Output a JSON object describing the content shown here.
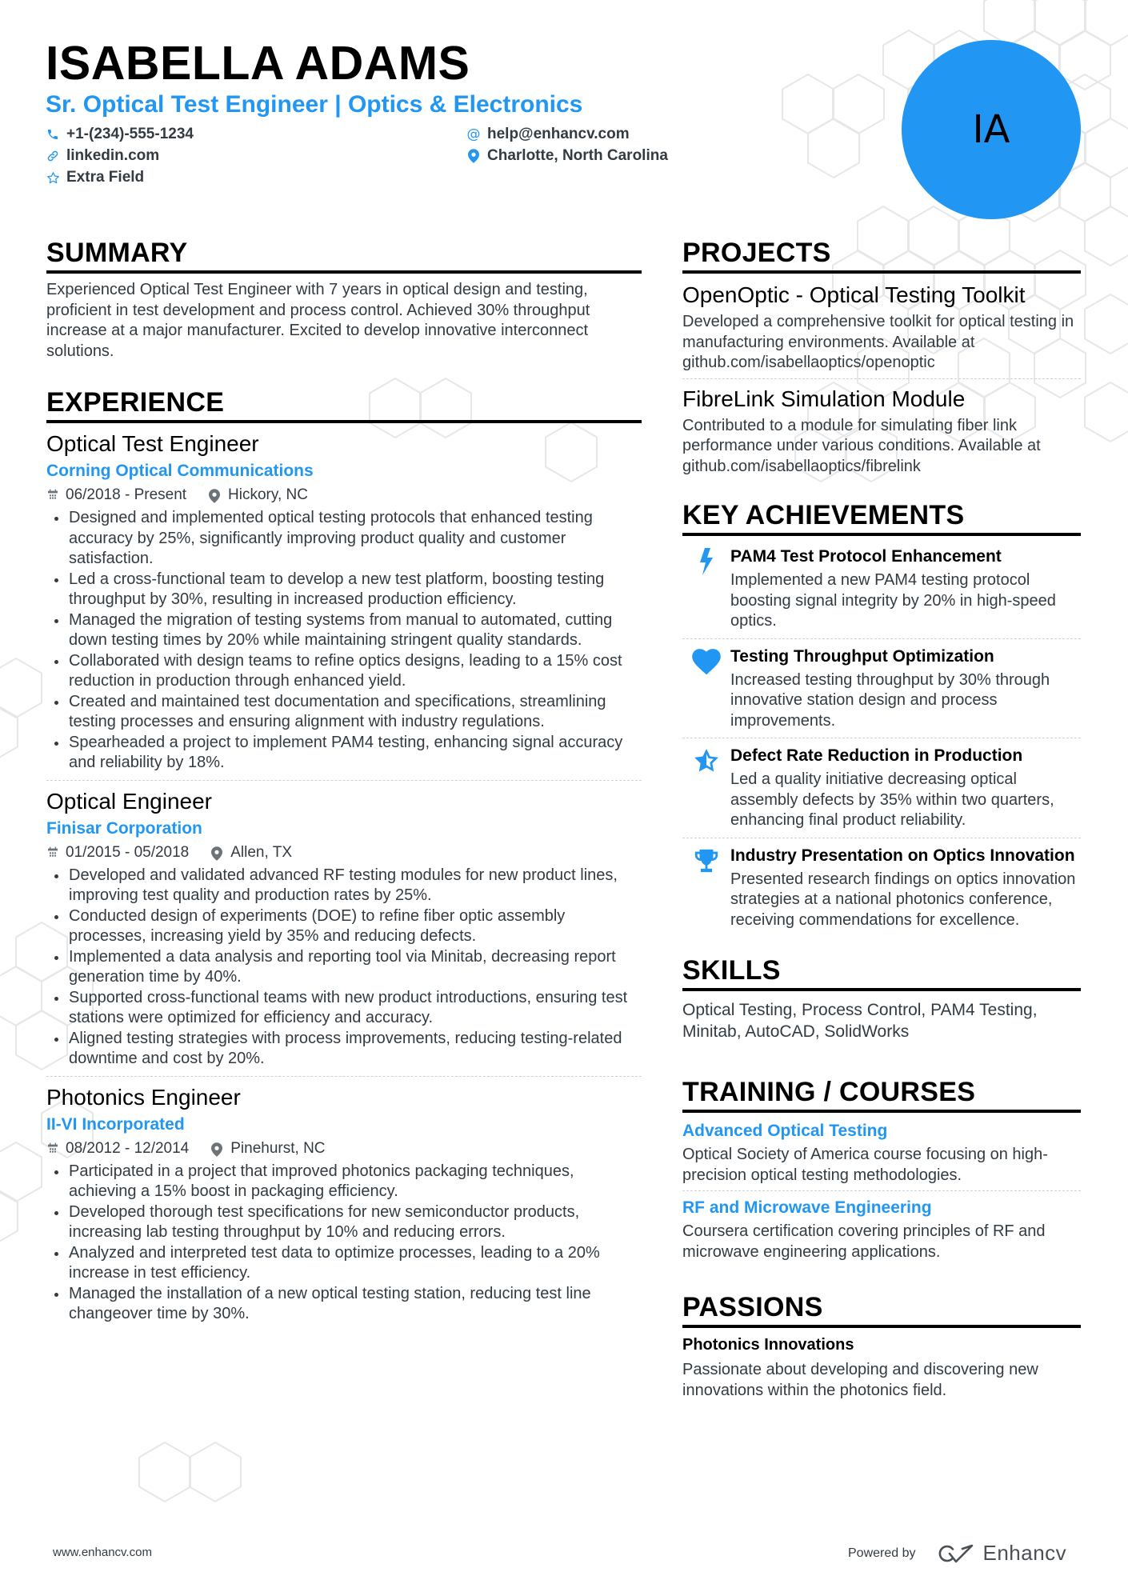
{
  "header": {
    "name": "ISABELLA ADAMS",
    "headline": "Sr. Optical Test Engineer | Optics & Electronics",
    "avatar_initials": "IA",
    "contacts": {
      "phone": "+1-(234)-555-1234",
      "email": "help@enhancv.com",
      "website": "linkedin.com",
      "location": "Charlotte, North Carolina",
      "extra": "Extra Field"
    }
  },
  "summary": {
    "title": "SUMMARY",
    "text": "Experienced Optical Test Engineer with 7 years in optical design and testing, proficient in test development and process control. Achieved 30% throughput increase at a major manufacturer. Excited to develop innovative interconnect solutions."
  },
  "experience": {
    "title": "EXPERIENCE",
    "items": [
      {
        "role": "Optical Test Engineer",
        "company": "Corning Optical Communications",
        "dates": "06/2018 - Present",
        "location": "Hickory, NC",
        "bullets": [
          "Designed and implemented optical testing protocols that enhanced testing accuracy by 25%, significantly improving product quality and customer satisfaction.",
          "Led a cross-functional team to develop a new test platform, boosting testing throughput by 30%, resulting in increased production efficiency.",
          "Managed the migration of testing systems from manual to automated, cutting down testing times by 20% while maintaining stringent quality standards.",
          "Collaborated with design teams to refine optics designs, leading to a 15% cost reduction in production through enhanced yield.",
          "Created and maintained test documentation and specifications, streamlining testing processes and ensuring alignment with industry regulations.",
          "Spearheaded a project to implement PAM4 testing, enhancing signal accuracy and reliability by 18%."
        ]
      },
      {
        "role": "Optical Engineer",
        "company": "Finisar Corporation",
        "dates": "01/2015 - 05/2018",
        "location": "Allen, TX",
        "bullets": [
          "Developed and validated advanced RF testing modules for new product lines, improving test quality and production rates by 25%.",
          "Conducted design of experiments (DOE) to refine fiber optic assembly processes, increasing yield by 35% and reducing defects.",
          "Implemented a data analysis and reporting tool via Minitab, decreasing report generation time by 40%.",
          "Supported cross-functional teams with new product introductions, ensuring test stations were optimized for efficiency and accuracy.",
          "Aligned testing strategies with process improvements, reducing testing-related downtime and cost by 20%."
        ]
      },
      {
        "role": "Photonics Engineer",
        "company": "II-VI Incorporated",
        "dates": "08/2012 - 12/2014",
        "location": "Pinehurst, NC",
        "bullets": [
          "Participated in a project that improved photonics packaging techniques, achieving a 15% boost in packaging efficiency.",
          "Developed thorough test specifications for new semiconductor products, increasing lab testing throughput by 10% and reducing errors.",
          "Analyzed and interpreted test data to optimize processes, leading to a 20% increase in test efficiency.",
          "Managed the installation of a new optical testing station, reducing test line changeover time by 30%."
        ]
      }
    ]
  },
  "projects": {
    "title": "PROJECTS",
    "items": [
      {
        "title": "OpenOptic - Optical Testing Toolkit",
        "description": "Developed a comprehensive toolkit for optical testing in manufacturing environments. Available at github.com/isabellaoptics/openoptic"
      },
      {
        "title": "FibreLink Simulation Module",
        "description": "Contributed to a module for simulating fiber link performance under various conditions. Available at github.com/isabellaoptics/fibrelink"
      }
    ]
  },
  "achievements": {
    "title": "KEY ACHIEVEMENTS",
    "items": [
      {
        "icon": "lightning-bolt-icon",
        "title": "PAM4 Test Protocol Enhancement",
        "description": "Implemented a new PAM4 testing protocol boosting signal integrity by 20% in high-speed optics."
      },
      {
        "icon": "heart-icon",
        "title": "Testing Throughput Optimization",
        "description": "Increased testing throughput by 30% through innovative station design and process improvements."
      },
      {
        "icon": "star-half-icon",
        "title": "Defect Rate Reduction in Production",
        "description": "Led a quality initiative decreasing optical assembly defects by 35% within two quarters, enhancing final product reliability."
      },
      {
        "icon": "trophy-icon",
        "title": "Industry Presentation on Optics Innovation",
        "description": "Presented research findings on optics innovation strategies at a national photonics conference, receiving commendations for excellence."
      }
    ]
  },
  "skills": {
    "title": "SKILLS",
    "text": "Optical Testing, Process Control, PAM4 Testing, Minitab, AutoCAD, SolidWorks"
  },
  "training": {
    "title": "TRAINING / COURSES",
    "items": [
      {
        "title": "Advanced Optical Testing",
        "description": "Optical Society of America course focusing on high-precision optical testing methodologies."
      },
      {
        "title": "RF and Microwave Engineering",
        "description": "Coursera certification covering principles of RF and microwave engineering applications."
      }
    ]
  },
  "passions": {
    "title": "PASSIONS",
    "items": [
      {
        "title": "Photonics Innovations",
        "description": "Passionate about developing and discovering new innovations within the photonics field."
      }
    ]
  },
  "footer": {
    "website": "www.enhancv.com",
    "powered_by": "Powered by",
    "brand": "Enhancv"
  },
  "colors": {
    "accent": "#2196f3",
    "text": "#333b42",
    "heading": "#000000"
  }
}
